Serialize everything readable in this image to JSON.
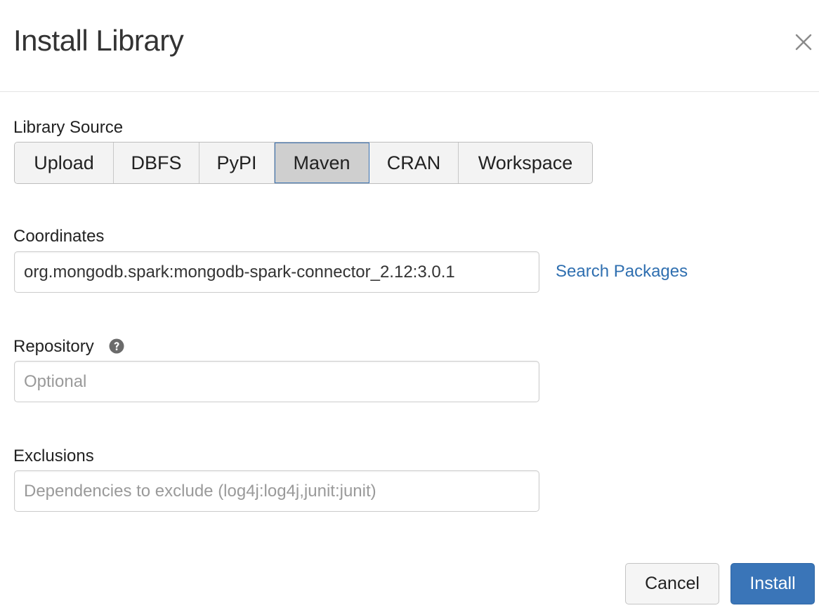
{
  "dialog": {
    "title": "Install Library",
    "close_icon": "close-icon"
  },
  "library_source": {
    "label": "Library Source",
    "options": [
      "Upload",
      "DBFS",
      "PyPI",
      "Maven",
      "CRAN",
      "Workspace"
    ],
    "selected": "Maven"
  },
  "coordinates": {
    "label": "Coordinates",
    "value": "org.mongodb.spark:mongodb-spark-connector_2.12:3.0.1",
    "search_link": "Search Packages"
  },
  "repository": {
    "label": "Repository",
    "help_icon": "question-circle-icon",
    "placeholder": "Optional",
    "value": ""
  },
  "exclusions": {
    "label": "Exclusions",
    "placeholder": "Dependencies to exclude (log4j:log4j,junit:junit)",
    "value": ""
  },
  "footer": {
    "cancel_label": "Cancel",
    "install_label": "Install"
  },
  "colors": {
    "primary": "#3a75b8",
    "link": "#2f6fb0",
    "selected_segment": "#cfcfcf",
    "selected_border": "#3b73b4"
  }
}
